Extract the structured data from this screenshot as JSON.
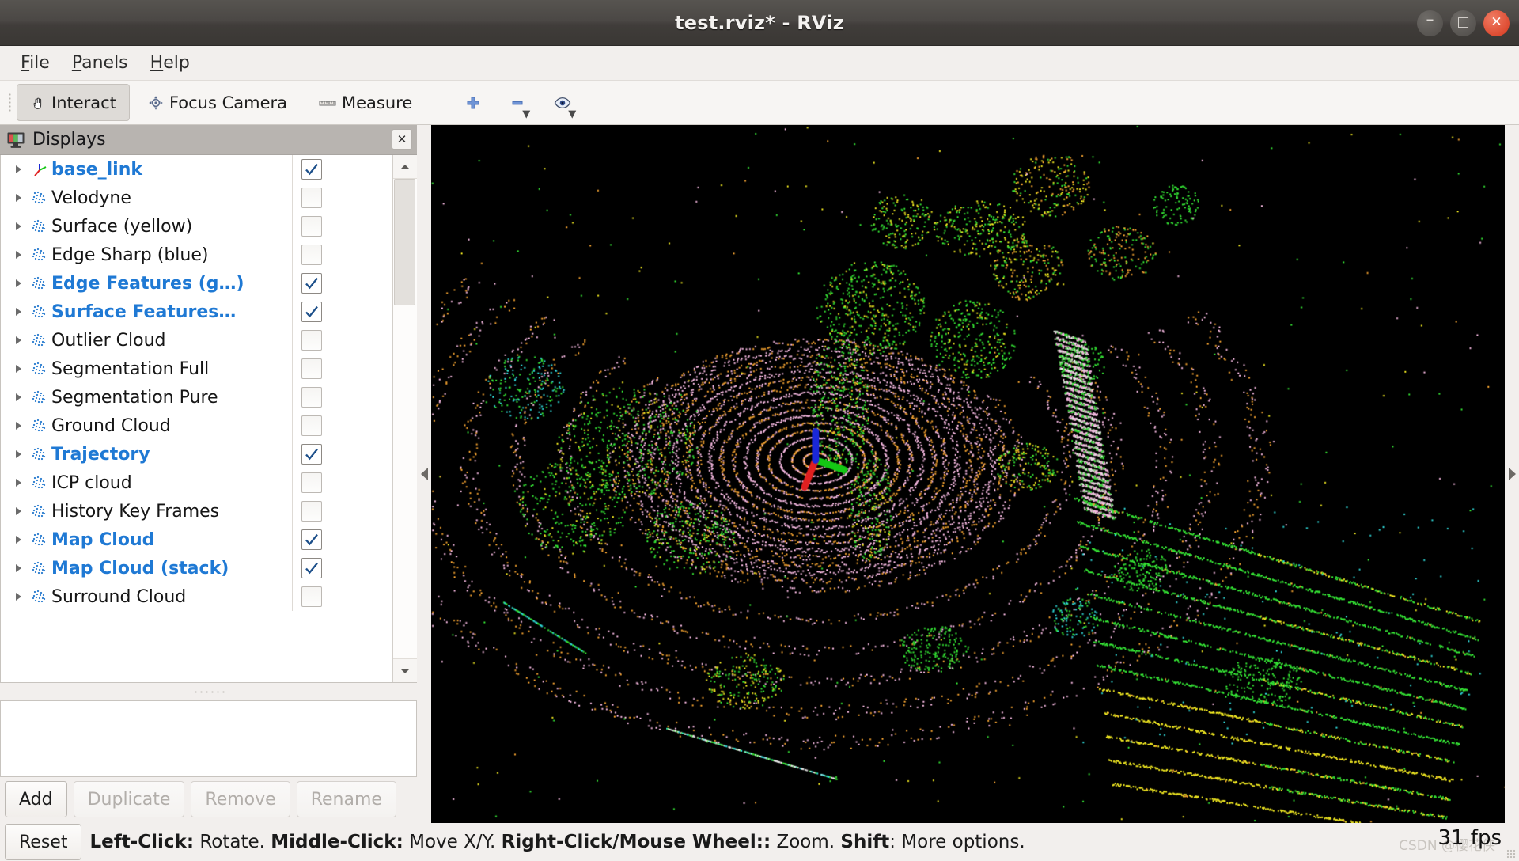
{
  "window": {
    "title": "test.rviz* - RViz",
    "minimize_label": "–",
    "maximize_label": "□",
    "close_label": "✕"
  },
  "menubar": {
    "items": [
      {
        "id": "file",
        "mnemonic": "F",
        "rest": "ile"
      },
      {
        "id": "panels",
        "mnemonic": "P",
        "rest": "anels"
      },
      {
        "id": "help",
        "mnemonic": "H",
        "rest": "elp"
      }
    ]
  },
  "toolbar": {
    "interact_label": "Interact",
    "focus_camera_label": "Focus Camera",
    "measure_label": "Measure",
    "icons": {
      "interact": "hand-cursor-icon",
      "focus_camera": "crosshair-icon",
      "measure": "ruler-icon",
      "add_pose": "plus-icon",
      "remove_pose": "minus-icon",
      "view_eye": "eye-icon"
    },
    "active": "Interact"
  },
  "displays_panel": {
    "header_title": "Displays",
    "header_icon": "monitor-icon",
    "close_button": "✕",
    "items": [
      {
        "label": "base_link",
        "icon": "axes-icon",
        "checked": true,
        "enabled": true
      },
      {
        "label": "Velodyne",
        "icon": "pointcloud-icon",
        "checked": false,
        "enabled": false
      },
      {
        "label": "Surface (yellow)",
        "icon": "pointcloud-icon",
        "checked": false,
        "enabled": false
      },
      {
        "label": "Edge Sharp (blue)",
        "icon": "pointcloud-icon",
        "checked": false,
        "enabled": false
      },
      {
        "label": "Edge Features (g…)",
        "icon": "pointcloud-icon",
        "checked": true,
        "enabled": true
      },
      {
        "label": "Surface Features…",
        "icon": "pointcloud-icon",
        "checked": true,
        "enabled": true
      },
      {
        "label": "Outlier Cloud",
        "icon": "pointcloud-icon",
        "checked": false,
        "enabled": false
      },
      {
        "label": "Segmentation Full",
        "icon": "pointcloud-icon",
        "checked": false,
        "enabled": false
      },
      {
        "label": "Segmentation Pure",
        "icon": "pointcloud-icon",
        "checked": false,
        "enabled": false
      },
      {
        "label": "Ground Cloud",
        "icon": "pointcloud-icon",
        "checked": false,
        "enabled": false
      },
      {
        "label": "Trajectory",
        "icon": "pointcloud-icon",
        "checked": true,
        "enabled": true
      },
      {
        "label": "ICP cloud",
        "icon": "pointcloud-icon",
        "checked": false,
        "enabled": false
      },
      {
        "label": "History Key Frames",
        "icon": "pointcloud-icon",
        "checked": false,
        "enabled": false
      },
      {
        "label": "Map Cloud",
        "icon": "pointcloud-icon",
        "checked": true,
        "enabled": true
      },
      {
        "label": "Map Cloud (stack)",
        "icon": "pointcloud-icon",
        "checked": true,
        "enabled": true
      },
      {
        "label": "Surround Cloud",
        "icon": "pointcloud-icon",
        "checked": false,
        "enabled": false
      }
    ],
    "buttons": [
      {
        "label": "Add",
        "enabled": true
      },
      {
        "label": "Duplicate",
        "enabled": false
      },
      {
        "label": "Remove",
        "enabled": false
      },
      {
        "label": "Rename",
        "enabled": false
      }
    ]
  },
  "statusbar": {
    "reset_label": "Reset",
    "hint_segments": [
      {
        "text": "Left-Click:",
        "bold": true
      },
      {
        "text": " Rotate. ",
        "bold": false
      },
      {
        "text": "Middle-Click:",
        "bold": true
      },
      {
        "text": " Move X/Y. ",
        "bold": false
      },
      {
        "text": "Right-Click/Mouse Wheel::",
        "bold": true
      },
      {
        "text": " Zoom. ",
        "bold": false
      },
      {
        "text": "Shift",
        "bold": true
      },
      {
        "text": ": More options.",
        "bold": false
      }
    ],
    "fps": "31 fps",
    "watermark": "CSDN @樱花侠"
  },
  "viewport": {
    "background_color": "#000000",
    "axes": {
      "x_color": "#e02020",
      "y_color": "#14c814",
      "z_color": "#1a28d8",
      "center_x": 0.358,
      "center_y": 0.48
    },
    "palette": {
      "green": "#33dd33",
      "yellow": "#e8e020",
      "orange": "#f0a030",
      "pink": "#f5b8e0",
      "cyan": "#30d8d8",
      "white": "#e8e8e8"
    }
  }
}
